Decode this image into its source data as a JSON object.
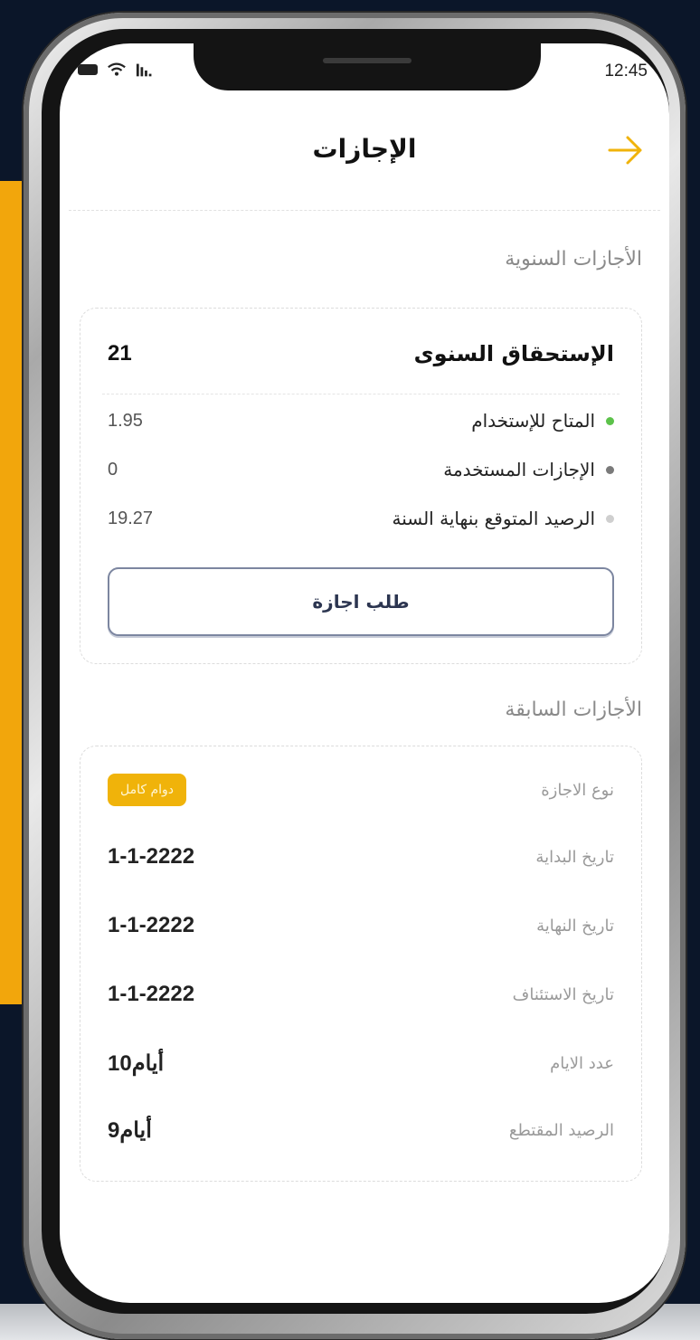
{
  "status_bar": {
    "time": "12:45"
  },
  "header": {
    "title": "الإجازات"
  },
  "annual": {
    "section_title": "الأجازات السنوية",
    "entitlement_label": "الإستحقاق السنوى",
    "entitlement_value": "21",
    "items": [
      {
        "label": "المتاح للإستخدام",
        "value": "1.95",
        "dot_color": "#5cc24a"
      },
      {
        "label": "الإجازات المستخدمة",
        "value": "0",
        "dot_color": "#7a7a7a"
      },
      {
        "label": "الرصيد المتوقع بنهاية السنة",
        "value": "19.27",
        "dot_color": "#cfcfcf"
      }
    ],
    "request_button": "طلب اجازة"
  },
  "previous": {
    "section_title": "الأجازات السابقة",
    "rows": [
      {
        "label": "نوع الاجازة",
        "value": "دوام كامل"
      },
      {
        "label": "تاريخ البداية",
        "value": "1-1-2222"
      },
      {
        "label": "تاريخ النهاية",
        "value": "1-1-2222"
      },
      {
        "label": "تاريخ الاستئناف",
        "value": "1-1-2222"
      },
      {
        "label": "عدد الايام",
        "value": "10أيام"
      },
      {
        "label": "الرصيد المقتطع",
        "value": "9أيام"
      }
    ]
  },
  "colors": {
    "accent": "#f0b30a",
    "background": "#0b1629",
    "button_border": "#7c86a0"
  }
}
